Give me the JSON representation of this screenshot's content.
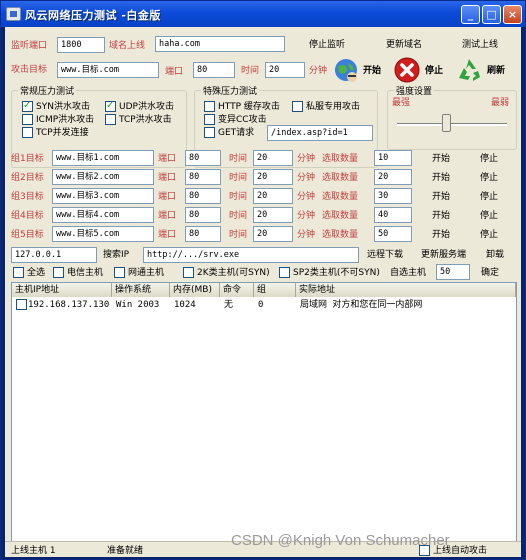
{
  "window": {
    "title": "风云网络压力测试 -白金版"
  },
  "top": {
    "listen_port_label": "监听端口",
    "listen_port": "1800",
    "domain_label": "域名上线",
    "domain": "haha.com",
    "stop_listen": "停止监听",
    "update_domain": "更新域名",
    "test_online": "测试上线"
  },
  "attack": {
    "target_label": "攻击目标",
    "target": "www.目标.com",
    "port_label": "端口",
    "port": "80",
    "time_label": "时间",
    "time": "20",
    "minute_label": "分钟",
    "start": "开始",
    "stop": "停止",
    "refresh": "刷新"
  },
  "normal": {
    "title": "常规压力测试",
    "syn": "SYN洪水攻击",
    "udp": "UDP洪水攻击",
    "icmp": "ICMP洪水攻击",
    "tcp": "TCP洪水攻击",
    "tcp_conn": "TCP并发连接"
  },
  "special": {
    "title": "特殊压力测试",
    "http": "HTTP 缓存攻击",
    "private": "私服专用攻击",
    "cc": "变异CC攻击",
    "get": "GET请求",
    "get_path": "/index.asp?id=1"
  },
  "strength": {
    "title": "强度设置",
    "strong": "最强",
    "weak": "最弱",
    "level": 0.45
  },
  "groups": [
    {
      "label": "组1目标",
      "target": "www.目标1.com",
      "port": "80",
      "time": "20",
      "qty": "10"
    },
    {
      "label": "组2目标",
      "target": "www.目标2.com",
      "port": "80",
      "time": "20",
      "qty": "20"
    },
    {
      "label": "组3目标",
      "target": "www.目标3.com",
      "port": "80",
      "time": "20",
      "qty": "30"
    },
    {
      "label": "组4目标",
      "target": "www.目标4.com",
      "port": "80",
      "time": "20",
      "qty": "40"
    },
    {
      "label": "组5目标",
      "target": "www.目标5.com",
      "port": "80",
      "time": "20",
      "qty": "50"
    }
  ],
  "group_labels": {
    "port": "端口",
    "time": "时间",
    "minute": "分钟",
    "select_qty": "选取数量",
    "start": "开始",
    "stop": "停止"
  },
  "remote": {
    "ip": "127.0.0.1",
    "search_ip": "搜索IP",
    "url": "http://.../srv.exe",
    "download": "远程下载",
    "update_service": "更新服务端",
    "uninstall": "卸载"
  },
  "filters": {
    "all": "全选",
    "telecom": "电信主机",
    "netcom": "网通主机",
    "twok": "2K类主机(可SYN)",
    "sp2": "SP2类主机(不可SYN)",
    "choose_host": "自选主机",
    "choose_value": "50",
    "confirm": "确定"
  },
  "table": {
    "columns": [
      "主机IP地址",
      "操作系统",
      "内存(MB)",
      "命令",
      "组",
      "实际地址"
    ],
    "rows": [
      [
        "192.168.137.130",
        "Win 2003",
        "1024",
        "无",
        "0",
        "局域网 对方和您在同一内部网"
      ]
    ]
  },
  "status": {
    "online": "上线主机 1",
    "ready": "准备就绪",
    "auto_attack": "上线自动攻击"
  },
  "watermark": "CSDN @Knigh Von Schumacher",
  "colors": {
    "title_blue": "#0b4bd8",
    "face": "#ece9d8",
    "label_red": "#c04040"
  }
}
